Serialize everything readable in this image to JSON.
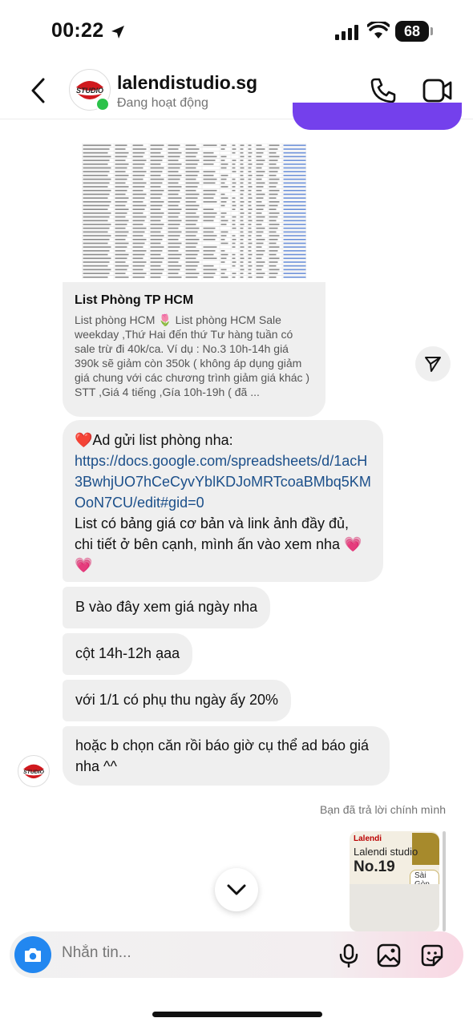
{
  "status_bar": {
    "time": "00:22",
    "battery": "68"
  },
  "header": {
    "contact_name": "lalendistudio.sg",
    "presence": "Đang hoạt động",
    "avatar_logo_text": "STUDIO"
  },
  "link_preview": {
    "title": "List Phòng TP HCM",
    "description": "List phòng HCM 🌷 List phòng HCM Sale weekday ,Thứ Hai đến thứ Tư hàng tuần có sale trừ đi 40k/ca. Ví dụ : No.3 10h-14h giá 390k sẽ giảm còn 350k ( không áp dụng giảm giá chung với các chương trình giảm giá khác ) STT ,Giá 4 tiếng ,Gía 10h-19h ( đã ..."
  },
  "messages": [
    {
      "heart": "❤️",
      "text": "Ad gửi list phòng nha:",
      "link": "https://docs.google.com/spreadsheets/d/1acH3BwhjUO7hCeCyvYblKDJoMRTcoaBMbq5KMOoN7CU/edit#gid=0",
      "text2": "List có bảng giá cơ bản và link ảnh đầy đủ, chi tiết ở bên cạnh, mình ấn vào xem nha",
      "emoji1": "💗",
      "emoji2": "💗"
    },
    {
      "text": "B vào đây xem giá ngày nha"
    },
    {
      "text": "cột 14h-12h ạaa"
    },
    {
      "text": "với 1/1 có phụ thu ngày ấy 20%"
    },
    {
      "text": "hoặc b chọn căn rồi báo giờ cụ thể ad báo giá nha ^^"
    }
  ],
  "reply": {
    "note": "Bạn đã trả lời chính mình",
    "image_logo": "Lalendi",
    "image_line1": "Lalendi studio",
    "image_line2": "No.19",
    "image_tag": "Sài Gòn"
  },
  "composer": {
    "placeholder": "Nhắn tin..."
  },
  "icons": [
    "location-arrow-icon",
    "signal-icon",
    "wifi-icon",
    "battery-icon",
    "back-chevron-icon",
    "phone-icon",
    "video-camera-icon",
    "share-send-icon",
    "chevron-down-icon",
    "camera-icon",
    "microphone-icon",
    "gallery-icon",
    "sticker-icon"
  ],
  "colors": {
    "sent_bubble": "#7440ec",
    "received_bubble": "#efefef",
    "camera_button": "#2287f0",
    "online": "#2bc24a",
    "link": "#1b4f8a"
  }
}
